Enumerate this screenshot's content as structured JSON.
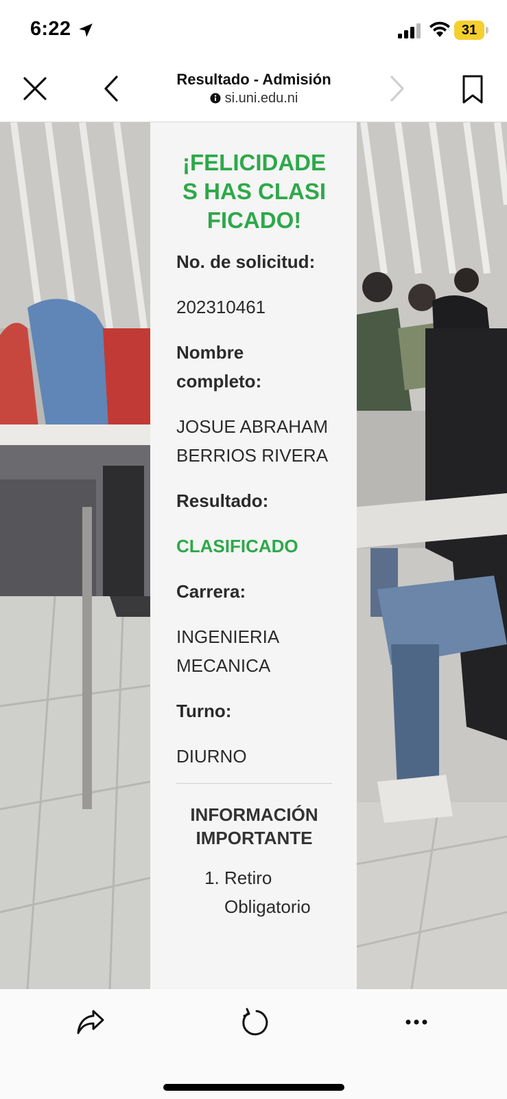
{
  "status_bar": {
    "time": "6:22",
    "battery_level": "31",
    "battery_color": "#f6cf2e"
  },
  "browser": {
    "title": "Resultado - Admisión",
    "url": "si.uni.edu.ni",
    "icons": {
      "close": "close-icon",
      "back": "chevron-left-icon",
      "forward": "chevron-right-icon",
      "bookmark": "bookmark-icon",
      "site_info": "info-icon"
    }
  },
  "card": {
    "heading": "¡FELICIDADES HAS CLASIFICADO!",
    "fields": [
      {
        "label": "No. de solicitud:",
        "value": "202310461"
      },
      {
        "label": "Nombre completo:",
        "value": "JOSUE ABRAHAM BERRIOS RIVERA"
      },
      {
        "label": "Resultado:",
        "value": "CLASIFICADO",
        "highlight": true
      },
      {
        "label": "Carrera:",
        "value": "INGENIERIA MECANICA"
      },
      {
        "label": "Turno:",
        "value": "DIURNO"
      }
    ],
    "info_heading": "INFORMACIÓN IMPORTANTE",
    "info_items": [
      "Retiro Obligatorio"
    ],
    "accent_color": "#2ea84a"
  },
  "toolbar": {
    "icons": [
      "share-icon",
      "reload-icon",
      "more-icon"
    ]
  }
}
